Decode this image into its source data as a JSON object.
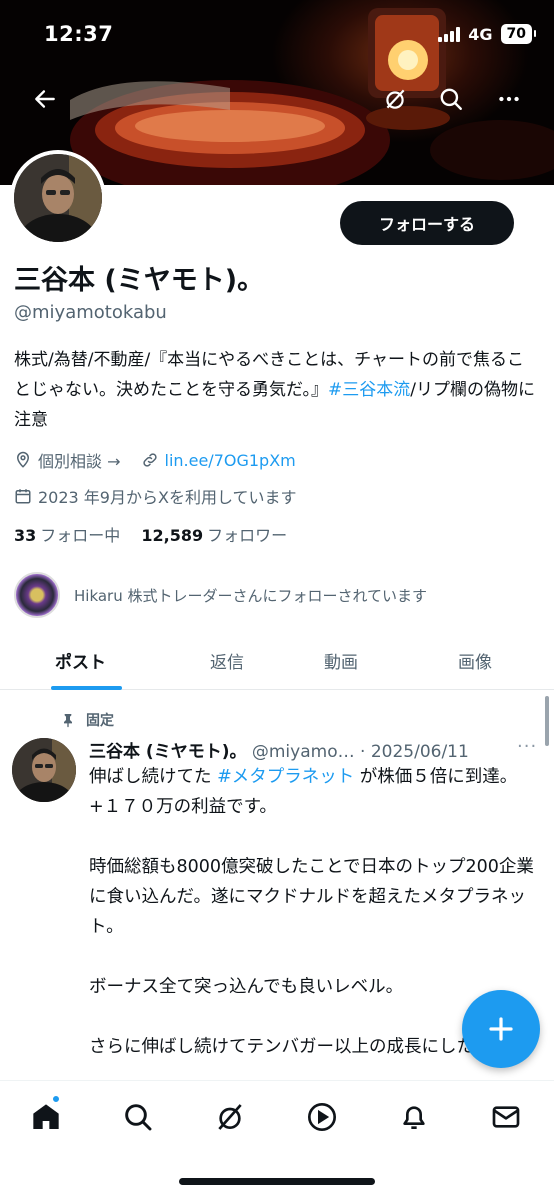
{
  "status_bar": {
    "time": "12:37",
    "network": "4G",
    "battery": "70"
  },
  "profile": {
    "follow_label": "フォローする",
    "name": "三谷本 (ミヤモト)。",
    "handle": "@miyamotokabu",
    "bio": {
      "text_1": "株式/為替/不動産/『本当にやるべきことは、チャートの前で焦ることじゃない。決めたことを守る勇気だ。』",
      "hashtag": "#三谷本流",
      "text_2": "/リプ欄の偽物に注意"
    },
    "consult_label": "個別相談 →",
    "link": "lin.ee/7OG1pXm",
    "joined": "2023 年9月からXを利用しています",
    "following_count": "33",
    "following_label": "フォロー中",
    "followers_count": "12,589",
    "followers_label": "フォロワー",
    "followed_by": "Hikaru 株式トレーダーさんにフォローされています"
  },
  "tabs": [
    "ポスト",
    "返信",
    "動画",
    "画像"
  ],
  "post": {
    "pinned_label": "固定",
    "author_name": "三谷本 (ミヤモト)。",
    "author_handle": "@miyamo…",
    "dot": "·",
    "date": "2025/06/11",
    "more": "···",
    "line1_prefix": "伸ばし続けてた ",
    "line1_tag": "#メタプラネット",
    "line1_suffix": " が株価５倍に到達。",
    "line2": "+１７０万の利益です。",
    "line3": "時価総額も8000億突破したことで日本のトップ200企業に食い込んだ。遂にマクドナルドを超えたメタプラネット。",
    "line4": "ボーナス全て突っ込んでも良いレベル。",
    "line5": "さらに伸ばし続けてテンバガー以上の成長にしたい。"
  },
  "colors": {
    "accent": "#1d9bf0",
    "text": "#0f1419",
    "muted": "#536471"
  },
  "icons": {
    "topbar": [
      "back-arrow-icon",
      "grok-icon",
      "search-icon",
      "more-icon"
    ],
    "nav": [
      "home-icon",
      "search-icon",
      "grok-icon",
      "video-icon",
      "notifications-icon",
      "messages-icon"
    ]
  }
}
